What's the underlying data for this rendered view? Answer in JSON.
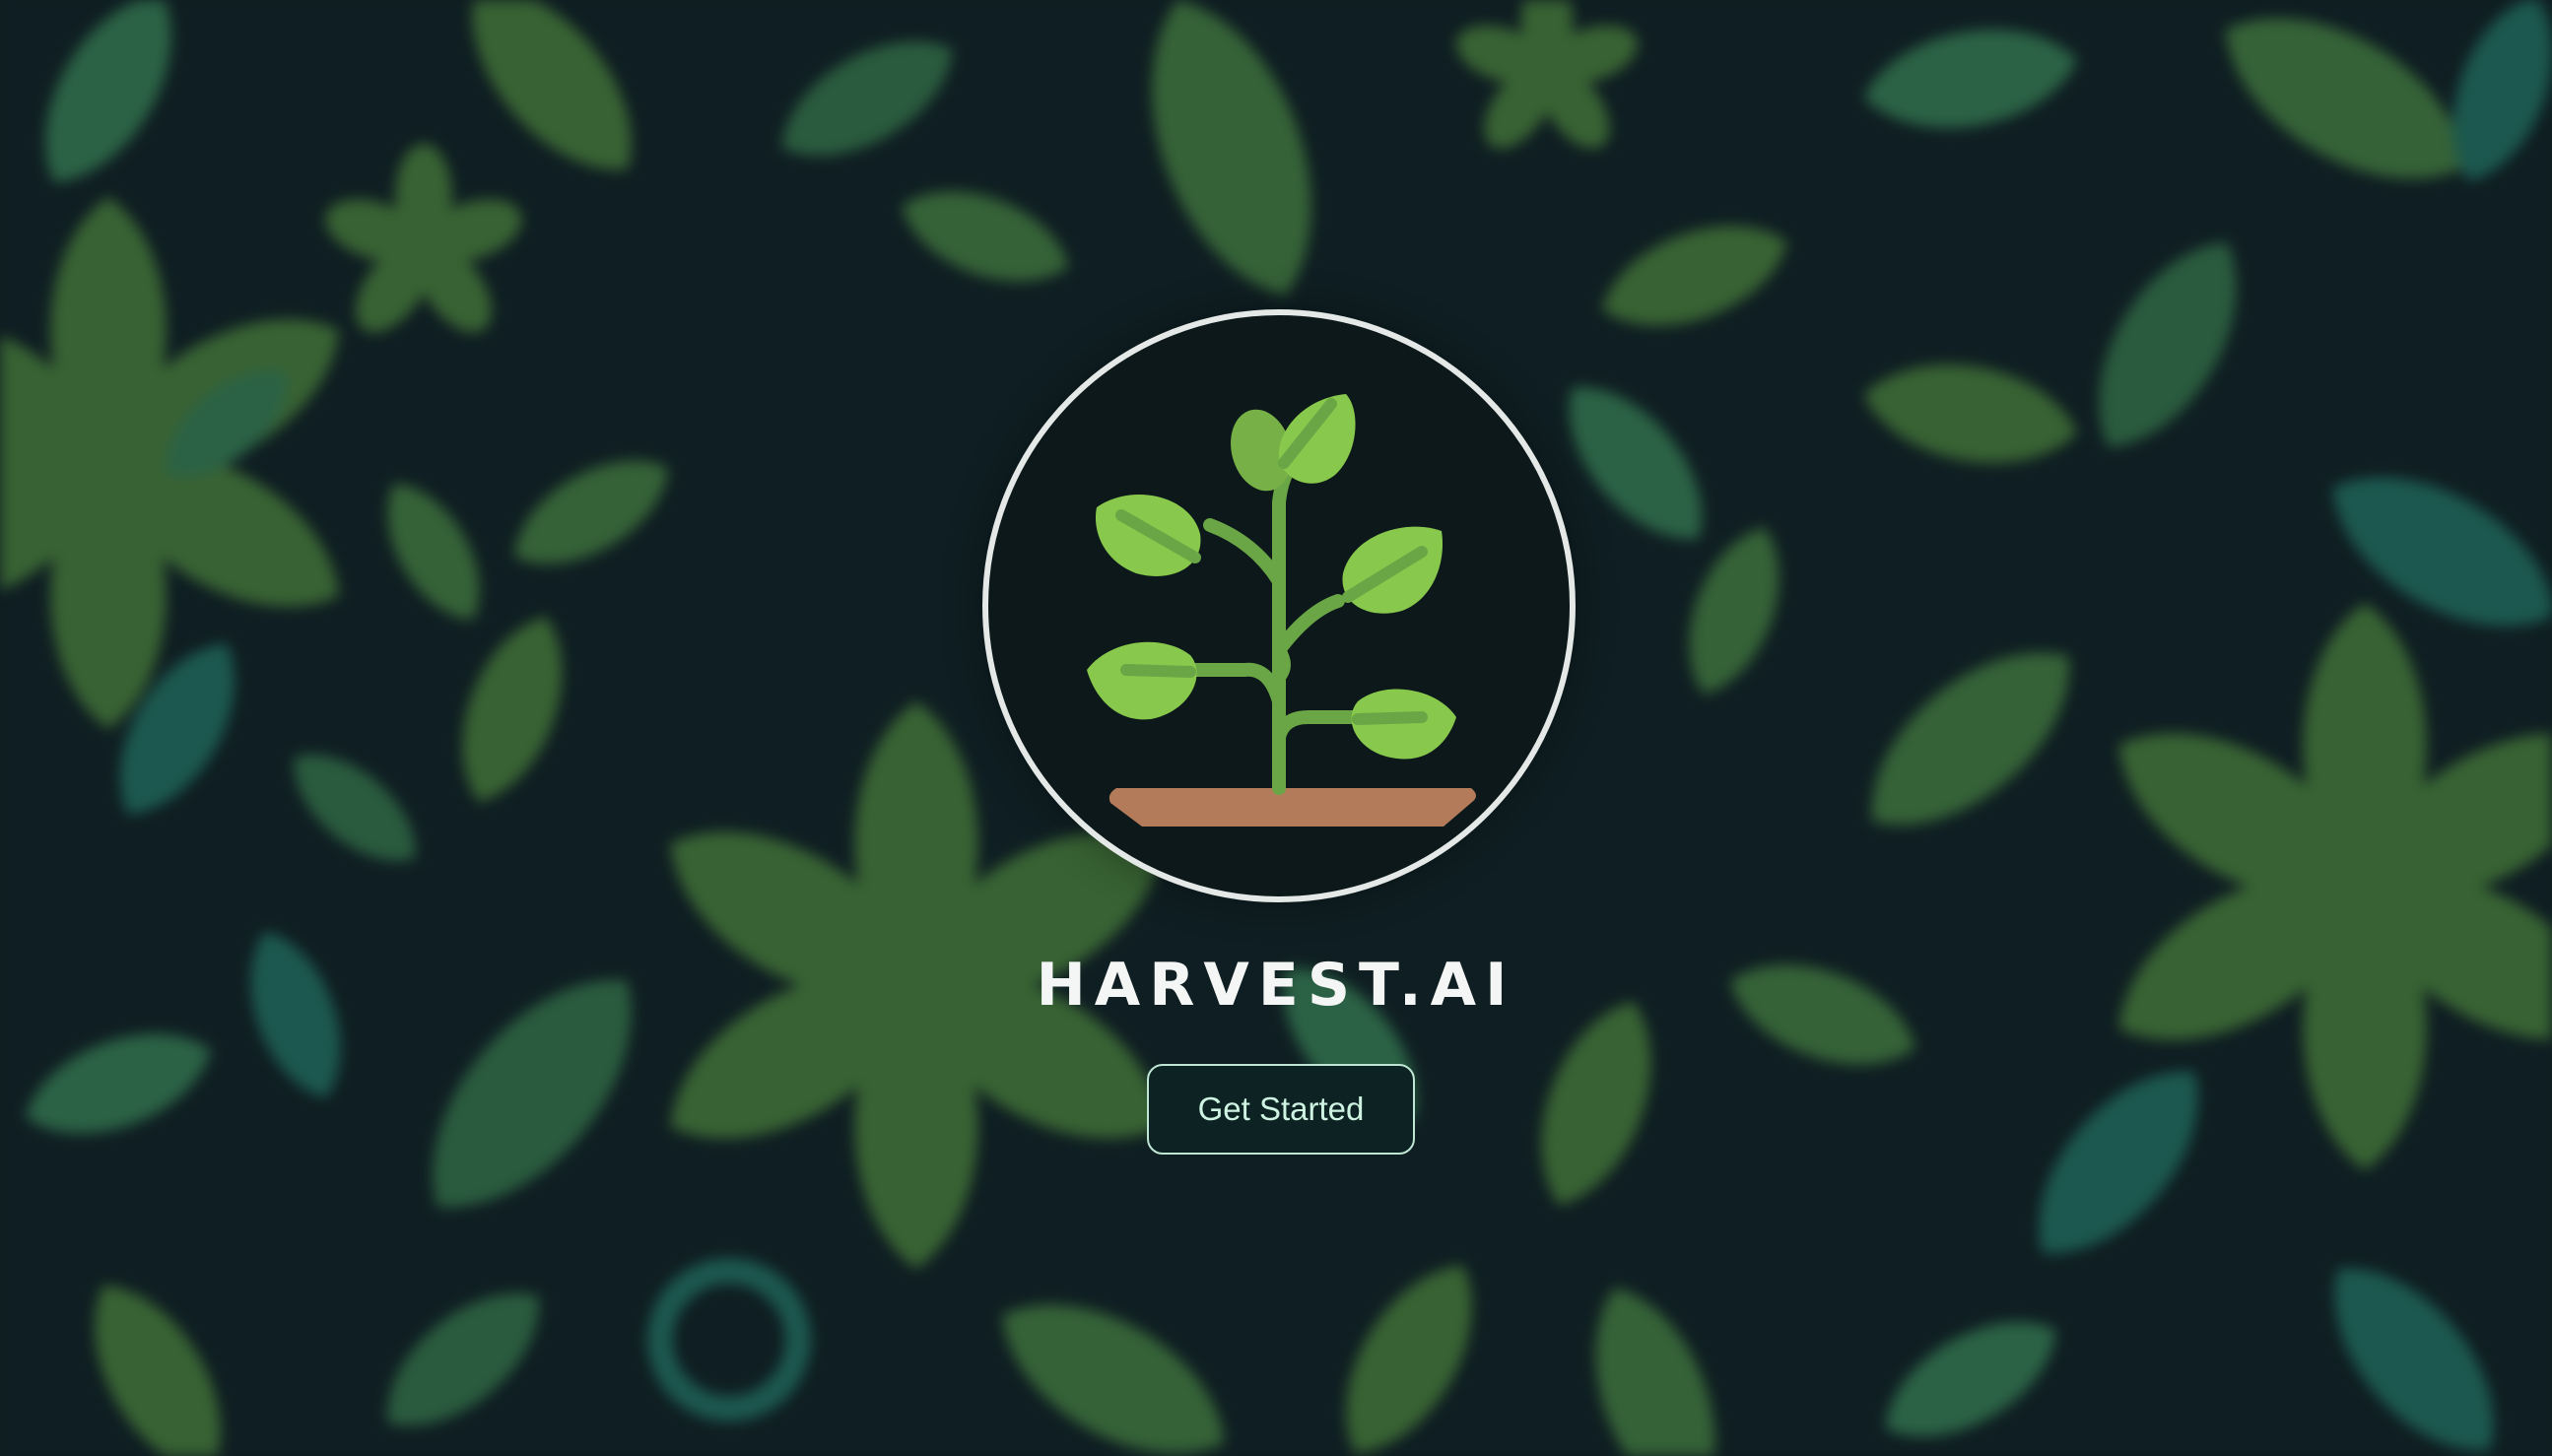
{
  "brand": {
    "name": "HARVEST.AI",
    "logo_icon": "sprout-in-soil-icon"
  },
  "actions": {
    "get_started_label": "Get Started"
  },
  "background": {
    "pattern": "blurred-leaf-pattern"
  },
  "colors": {
    "page_background": "#0f1e22",
    "circle_fill": "#0c1819",
    "circle_border": "#e4e8e6",
    "leaf_light": "#7ec24a",
    "stem": "#6aa646",
    "soil": "#b47b5a",
    "title_text": "#f4f6f5",
    "button_border": "#bfe6d4",
    "button_text": "#cff3e2"
  }
}
